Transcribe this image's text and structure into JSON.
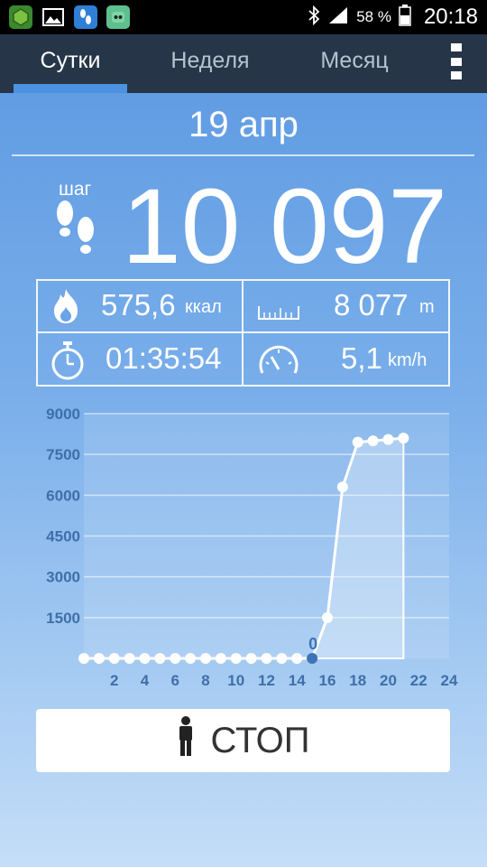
{
  "status_bar": {
    "battery": "58 %",
    "time": "20:18"
  },
  "tabs": [
    {
      "label": "Сутки",
      "active": true
    },
    {
      "label": "Неделя",
      "active": false
    },
    {
      "label": "Месяц",
      "active": false
    }
  ],
  "date": "19 апр",
  "steps": {
    "label": "шаг",
    "value": "10 097"
  },
  "stats": {
    "calories": {
      "value": "575,6",
      "unit": "ккал",
      "icon": "flame-icon"
    },
    "distance": {
      "value": "8 077",
      "unit": "m",
      "icon": "ruler-icon"
    },
    "duration": {
      "value": "01:35:54",
      "icon": "stopwatch-icon"
    },
    "speed": {
      "value": "5,1",
      "unit": "km/h",
      "icon": "speedometer-icon"
    }
  },
  "chart_data": {
    "type": "line",
    "x": [
      0,
      1,
      2,
      3,
      4,
      5,
      6,
      7,
      8,
      9,
      10,
      11,
      12,
      13,
      14,
      15,
      16,
      17,
      18,
      19,
      20,
      21
    ],
    "values": [
      0,
      0,
      0,
      0,
      0,
      0,
      0,
      0,
      0,
      0,
      0,
      0,
      0,
      0,
      0,
      0,
      1500,
      6300,
      7950,
      8000,
      8050,
      8100
    ],
    "xticks": [
      2,
      4,
      6,
      8,
      10,
      12,
      14,
      16,
      18,
      20,
      22,
      24
    ],
    "yticks": [
      1500,
      3000,
      4500,
      6000,
      7500,
      9000
    ],
    "ylim": [
      0,
      9000
    ],
    "xlim": [
      0,
      24
    ],
    "highlight": {
      "x": 15,
      "label": "0"
    },
    "grid": true,
    "line_color": "#ffffff",
    "tick_color": "#3f6fa8"
  },
  "stop_button": {
    "label": "СТОП",
    "icon": "person-icon"
  }
}
